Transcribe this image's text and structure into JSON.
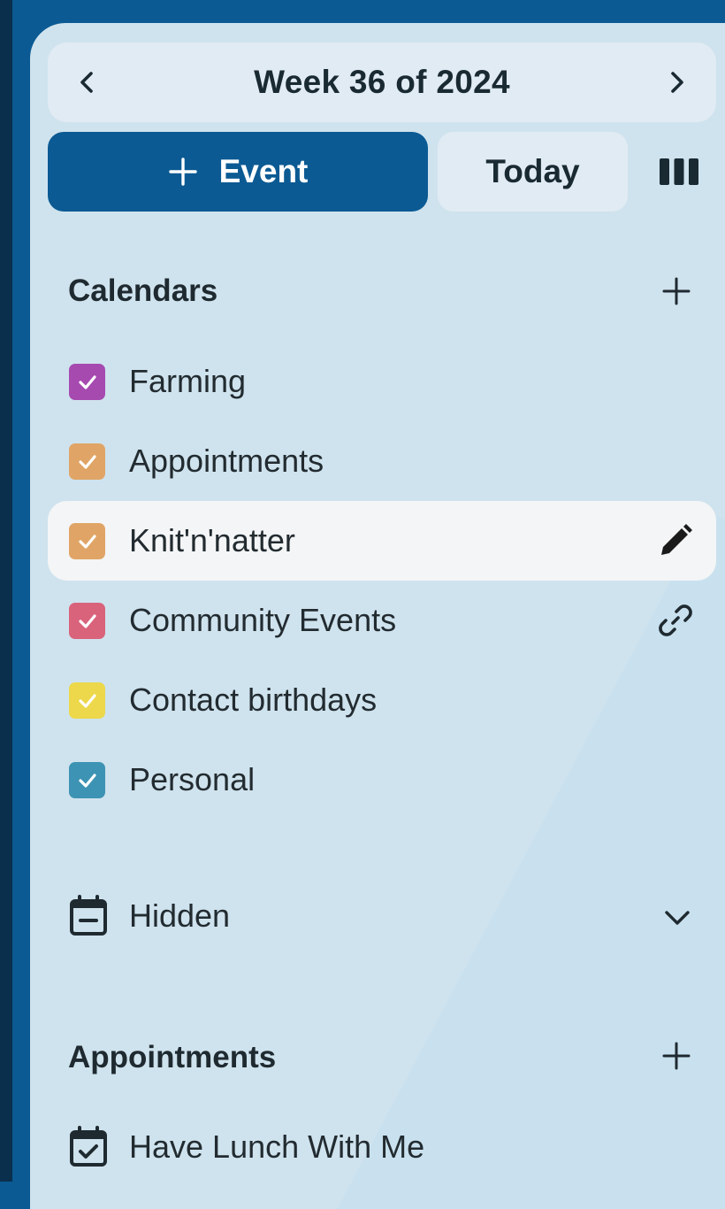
{
  "header": {
    "week_title": "Week 36 of 2024",
    "new_event_label": "Event",
    "today_label": "Today"
  },
  "calendars_section": {
    "title": "Calendars",
    "items": [
      {
        "label": "Farming",
        "color": "#a64ab0",
        "checked": true
      },
      {
        "label": "Appointments",
        "color": "#e0a566",
        "checked": true
      },
      {
        "label": "Knit'n'natter",
        "color": "#e0a566",
        "checked": true,
        "selected": true,
        "action_icon": "pencil-icon"
      },
      {
        "label": "Community Events",
        "color": "#d9637b",
        "checked": true,
        "action_icon": "link-icon"
      },
      {
        "label": "Contact birthdays",
        "color": "#ecd84a",
        "checked": true
      },
      {
        "label": "Personal",
        "color": "#3d93b3",
        "checked": true
      }
    ]
  },
  "hidden_group": {
    "label": "Hidden",
    "icon": "calendar-minus-icon",
    "expander_icon": "chevron-down-icon"
  },
  "appointments_section": {
    "title": "Appointments",
    "items": [
      {
        "label": "Have Lunch With Me",
        "icon": "calendar-check-icon"
      }
    ]
  },
  "colors": {
    "accent": "#0b5a93",
    "sidebar_bg": "#cfe3ee",
    "button_bg": "#e1ebf3",
    "selected_row_bg": "#f4f5f6"
  }
}
